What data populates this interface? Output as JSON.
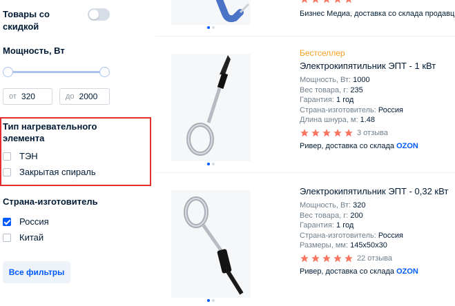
{
  "sidebar": {
    "discount_title": "Товары со скидкой",
    "power_title": "Мощность, Вт",
    "power_from_prefix": "от",
    "power_from_value": "320",
    "power_to_prefix": "до",
    "power_to_value": "2000",
    "heater_title": "Тип нагревательного элемента",
    "heater_options": [
      "ТЭН",
      "Закрытая спираль"
    ],
    "country_title": "Страна-изготовитель",
    "country_options": [
      "Россия",
      "Китай"
    ],
    "all_filters_label": "Все фильтры"
  },
  "products": [
    {
      "seller_prefix": "Бизнес Медиа",
      "seller_rest": ", доставка со склада продавц"
    },
    {
      "badge": "Бестселлер",
      "title": "Электрокипятильник ЭПТ - 1 кВт",
      "specs": [
        {
          "label": "Мощность, Вт:",
          "value": "1000"
        },
        {
          "label": "Вес товара, г:",
          "value": "235"
        },
        {
          "label": "Гарантия:",
          "value": "1 год"
        },
        {
          "label": "Страна-изготовитель:",
          "value": "Россия"
        },
        {
          "label": "Длина шнура, м:",
          "value": "1.48"
        }
      ],
      "reviews": "3 отзыва",
      "seller_prefix": "Ривер, доставка со склада",
      "seller_brand": "OZON"
    },
    {
      "title": "Электрокипятильник ЭПТ - 0,32 кВт",
      "specs": [
        {
          "label": "Мощность, Вт:",
          "value": "320"
        },
        {
          "label": "Вес товара, г:",
          "value": "200"
        },
        {
          "label": "Гарантия:",
          "value": "1 год"
        },
        {
          "label": "Страна-изготовитель:",
          "value": "Россия"
        },
        {
          "label": "Размеры, мм:",
          "value": "145x50x30"
        }
      ],
      "reviews": "22 отзыва",
      "seller_prefix": "Ривер, доставка со склада",
      "seller_brand": "OZON"
    }
  ],
  "colors": {
    "accent": "#005bff",
    "star": "#f97460",
    "bestseller": "#f99e1c",
    "highlight_border": "#e52d2d"
  }
}
